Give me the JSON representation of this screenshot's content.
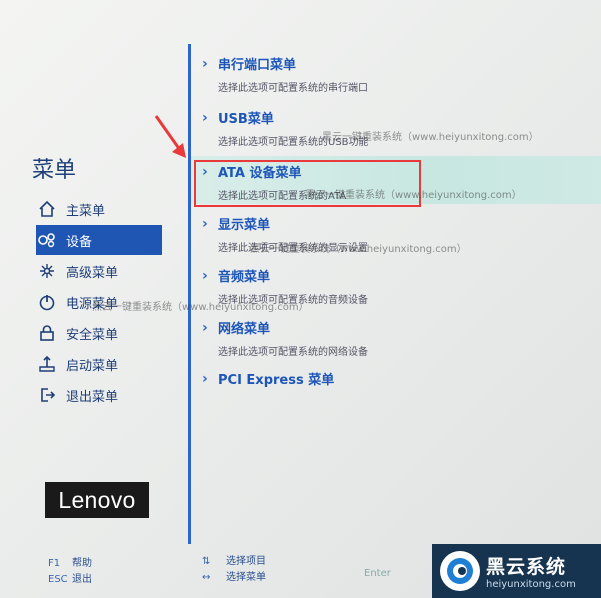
{
  "sidebar": {
    "title": "菜单",
    "items": [
      {
        "label": "主菜单",
        "icon": "home-icon"
      },
      {
        "label": "设备",
        "icon": "devices-icon"
      },
      {
        "label": "高级菜单",
        "icon": "advanced-icon"
      },
      {
        "label": "电源菜单",
        "icon": "power-icon"
      },
      {
        "label": "安全菜单",
        "icon": "lock-icon"
      },
      {
        "label": "启动菜单",
        "icon": "boot-icon"
      },
      {
        "label": "退出菜单",
        "icon": "exit-icon"
      }
    ],
    "active_index": 1
  },
  "logo_text": "Lenovo",
  "menu_entries": [
    {
      "title": "串行端口菜单",
      "desc": "选择此选项可配置系统的串行端口"
    },
    {
      "title": "USB菜单",
      "desc": "选择此选项可配置系统的USB功能"
    },
    {
      "title": "ATA 设备菜单",
      "desc": "选择此选项可配置系统的ATA"
    },
    {
      "title": "显示菜单",
      "desc": "选择此选项可配置系统的显示设置"
    },
    {
      "title": "音频菜单",
      "desc": "选择此选项可配置系统的音频设备"
    },
    {
      "title": "网络菜单",
      "desc": "选择此选项可配置系统的网络设备"
    },
    {
      "title": "PCI Express 菜单",
      "desc": ""
    }
  ],
  "selected_entry_index": 2,
  "watermarks": [
    "黑云一键重装系统（www.heiyunxitong.com）",
    "黑云一键重装系统（www.heiyunxitong.com）",
    "黑云一键重装系统（www.heiyunxitong.com）",
    "黑云一键重装系统（www.heiyunxitong.com）"
  ],
  "footer": {
    "help_key": "F1",
    "help_label": "帮助",
    "exit_key": "ESC",
    "exit_label": "退出",
    "select_item_key": "⇅",
    "select_item_label": "选择项目",
    "select_menu_key": "↔",
    "select_menu_label": "选择菜单",
    "enter_hint": "Enter"
  },
  "brand": {
    "name": "黑云系统",
    "url": "heiyunxitong.com"
  },
  "colors": {
    "accent": "#1f56b4",
    "highlight": "#c8e7e1",
    "annotation_red": "#e83a3a"
  }
}
